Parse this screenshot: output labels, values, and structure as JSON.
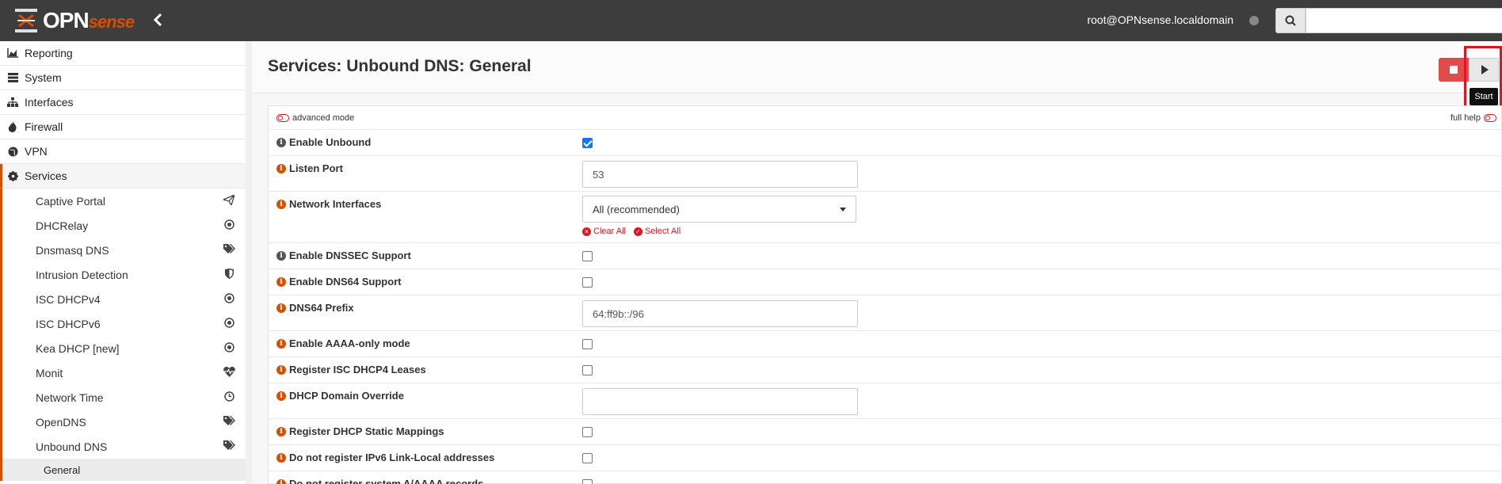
{
  "header": {
    "logo_main": "OPN",
    "logo_sub": "sense",
    "user": "root@OPNsense.localdomain",
    "search_placeholder": ""
  },
  "sidebar": {
    "top_items": [
      {
        "label": "Reporting",
        "icon": "area-chart-icon"
      },
      {
        "label": "System",
        "icon": "server-icon"
      },
      {
        "label": "Interfaces",
        "icon": "sitemap-icon"
      },
      {
        "label": "Firewall",
        "icon": "fire-icon"
      },
      {
        "label": "VPN",
        "icon": "globe-icon"
      },
      {
        "label": "Services",
        "icon": "cog-icon"
      }
    ],
    "services_items": [
      {
        "label": "Captive Portal",
        "icon": "paper-plane-icon"
      },
      {
        "label": "DHCRelay",
        "icon": "bullseye-icon"
      },
      {
        "label": "Dnsmasq DNS",
        "icon": "tags-icon"
      },
      {
        "label": "Intrusion Detection",
        "icon": "shield-icon"
      },
      {
        "label": "ISC DHCPv4",
        "icon": "bullseye-icon"
      },
      {
        "label": "ISC DHCPv6",
        "icon": "bullseye-icon"
      },
      {
        "label": "Kea DHCP [new]",
        "icon": "bullseye-icon"
      },
      {
        "label": "Monit",
        "icon": "heartbeat-icon"
      },
      {
        "label": "Network Time",
        "icon": "clock-icon"
      },
      {
        "label": "OpenDNS",
        "icon": "tags-icon"
      },
      {
        "label": "Unbound DNS",
        "icon": "tags-icon"
      }
    ],
    "unbound_sub": "General"
  },
  "page": {
    "title": "Services: Unbound DNS: General",
    "tooltip": "Start",
    "advanced_mode": "advanced mode",
    "full_help": "full help"
  },
  "form": {
    "enable_unbound": "Enable Unbound",
    "listen_port": "Listen Port",
    "listen_port_value": "53",
    "network_interfaces": "Network Interfaces",
    "network_interfaces_value": "All (recommended)",
    "clear_all": "Clear All",
    "select_all": "Select All",
    "enable_dnssec": "Enable DNSSEC Support",
    "enable_dns64": "Enable DNS64 Support",
    "dns64_prefix": "DNS64 Prefix",
    "dns64_prefix_value": "64:ff9b::/96",
    "enable_aaaa_only": "Enable AAAA-only mode",
    "register_dhcp4": "Register ISC DHCP4 Leases",
    "dhcp_domain_override": "DHCP Domain Override",
    "dhcp_domain_override_value": "",
    "register_static": "Register DHCP Static Mappings",
    "no_ipv6_linklocal": "Do not register IPv6 Link-Local addresses",
    "no_system_records": "Do not register system A/AAAA records"
  },
  "colors": {
    "topbar": "#3d3d3d",
    "accent": "#d94f00",
    "stop": "#e04c4c",
    "highlight": "#e0141e"
  }
}
